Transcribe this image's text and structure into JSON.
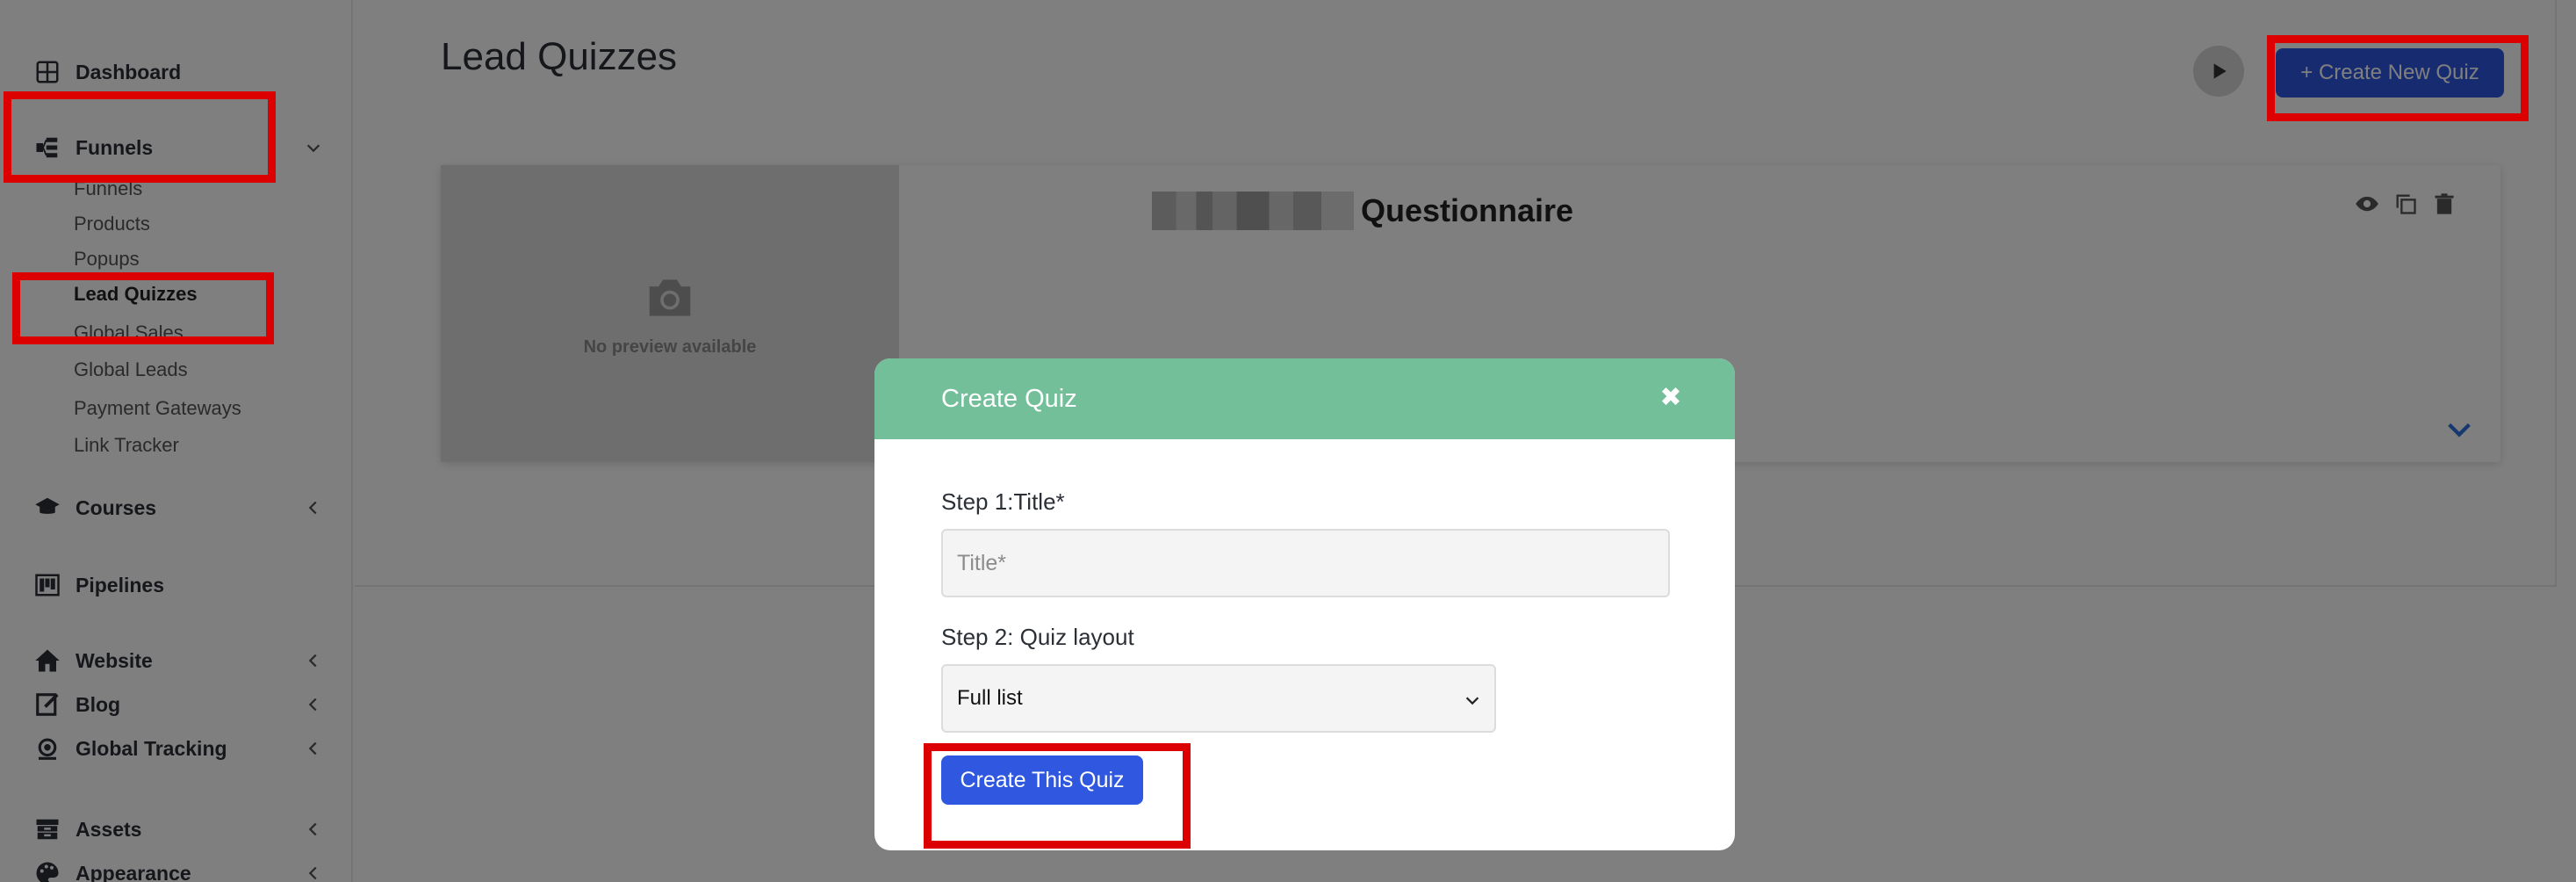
{
  "sidebar": {
    "items": [
      {
        "label": "Dashboard",
        "icon": "dashboard-icon"
      },
      {
        "label": "Funnels",
        "icon": "funnel-icon",
        "expanded": true
      },
      {
        "label": "Courses",
        "icon": "graduation-cap-icon"
      },
      {
        "label": "Pipelines",
        "icon": "pipeline-icon"
      },
      {
        "label": "Website",
        "icon": "home-icon"
      },
      {
        "label": "Blog",
        "icon": "edit-icon"
      },
      {
        "label": "Global Tracking",
        "icon": "tracking-icon"
      },
      {
        "label": "Assets",
        "icon": "archive-icon"
      },
      {
        "label": "Appearance",
        "icon": "palette-icon"
      }
    ],
    "funnel_subitems": [
      {
        "label": "Funnels"
      },
      {
        "label": "Products"
      },
      {
        "label": "Popups"
      },
      {
        "label": "Lead Quizzes",
        "active": true
      },
      {
        "label": "Global Sales"
      },
      {
        "label": "Global Leads"
      },
      {
        "label": "Payment Gateways"
      },
      {
        "label": "Link Tracker"
      }
    ]
  },
  "main": {
    "title": "Lead Quizzes",
    "create_button": "+ Create New Quiz",
    "quiz_card": {
      "preview_text": "No preview available",
      "title": "Questionnaire"
    }
  },
  "modal": {
    "title": "Create Quiz",
    "close_symbol": "✖",
    "step1_label": "Step 1:Title*",
    "title_placeholder": "Title*",
    "title_value": "",
    "step2_label": "Step 2: Quiz layout",
    "layout_selected": "Full list",
    "submit_label": "Create This Quiz"
  },
  "colors": {
    "accent": "#2f57e0",
    "modal_header": "#73bf99",
    "highlight": "#dd0000",
    "overlay": "rgba(0,0,0,0.5)"
  }
}
